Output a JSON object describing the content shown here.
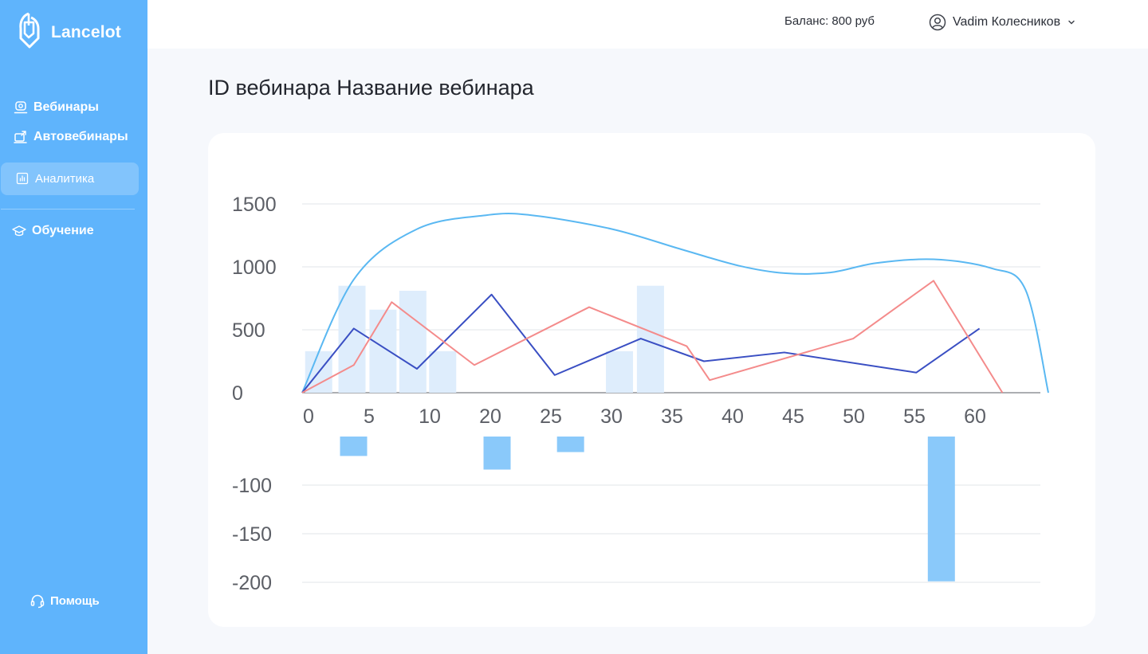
{
  "app": {
    "name": "Lancelot"
  },
  "sidebar": {
    "items": [
      {
        "label": "Вебинары",
        "icon": "webinar-icon"
      },
      {
        "label": "Автовебинары",
        "icon": "autowebinar-icon"
      },
      {
        "label": "Аналитика",
        "icon": "analytics-icon",
        "active": true
      },
      {
        "label": "Обучение",
        "icon": "graduation-cap-icon"
      }
    ],
    "help_label": "Помощь",
    "help_icon": "headset-icon"
  },
  "header": {
    "balance": "Баланс: 800 руб",
    "user_name": "Vadim Колесников",
    "user_icon": "user-avatar-icon",
    "dropdown_icon": "chevron-down-icon"
  },
  "page": {
    "title": "ID вебинара Название вебинара"
  },
  "colors": {
    "sidebar": "#5fb4fc",
    "curve": "#5ab8f2",
    "line_dark": "#3a4fc3",
    "line_red": "#f48b8b",
    "bar_pos": "#deedfc",
    "bar_neg": "#8ac9fa"
  },
  "chart_data": {
    "type": "bar",
    "x_ticks": [
      "0",
      "5",
      "10",
      "20",
      "25",
      "30",
      "35",
      "40",
      "45",
      "50",
      "55",
      "60"
    ],
    "y_ticks_positive": [
      "1500",
      "1000",
      "500",
      "0"
    ],
    "y_ticks_negative": [
      "-100",
      "-150",
      "-200"
    ],
    "ylim_positive": [
      0,
      1500
    ],
    "ylim_negative": [
      -50,
      -200
    ],
    "grid": true,
    "positive_bars": [
      {
        "x": 0.4,
        "value": 330
      },
      {
        "x": 3.3,
        "value": 850
      },
      {
        "x": 6.0,
        "value": 660
      },
      {
        "x": 8.6,
        "value": 810
      },
      {
        "x": 11.2,
        "value": 330
      },
      {
        "x": 26.6,
        "value": 330
      },
      {
        "x": 29.3,
        "value": 850
      }
    ],
    "negative_bars": [
      {
        "x": 3.3,
        "value": -70
      },
      {
        "x": 15.8,
        "value": -84
      },
      {
        "x": 22.2,
        "value": -66
      },
      {
        "x": 54.5,
        "value": -199
      }
    ],
    "series": [
      {
        "style": "smooth",
        "points": [
          [
            0,
            0
          ],
          [
            4.5,
            900
          ],
          [
            10,
            1300
          ],
          [
            16,
            1410
          ],
          [
            20,
            1410
          ],
          [
            27,
            1300
          ],
          [
            33,
            1140
          ],
          [
            38,
            1010
          ],
          [
            42,
            950
          ],
          [
            46,
            955
          ],
          [
            50,
            1030
          ],
          [
            55,
            1060
          ],
          [
            60,
            990
          ],
          [
            63,
            820
          ],
          [
            65,
            0
          ]
        ]
      },
      {
        "style": "line",
        "points": [
          [
            0,
            0
          ],
          [
            4.5,
            510
          ],
          [
            10,
            190
          ],
          [
            16.5,
            780
          ],
          [
            22,
            140
          ],
          [
            29.5,
            430
          ],
          [
            35,
            250
          ],
          [
            42,
            320
          ],
          [
            53.5,
            160
          ],
          [
            59,
            510
          ]
        ]
      },
      {
        "style": "line",
        "points": [
          [
            0,
            0
          ],
          [
            4.5,
            220
          ],
          [
            7.8,
            720
          ],
          [
            15,
            220
          ],
          [
            25,
            680
          ],
          [
            33.5,
            370
          ],
          [
            35.5,
            100
          ],
          [
            48,
            430
          ],
          [
            55,
            890
          ],
          [
            61,
            0
          ]
        ]
      }
    ]
  }
}
